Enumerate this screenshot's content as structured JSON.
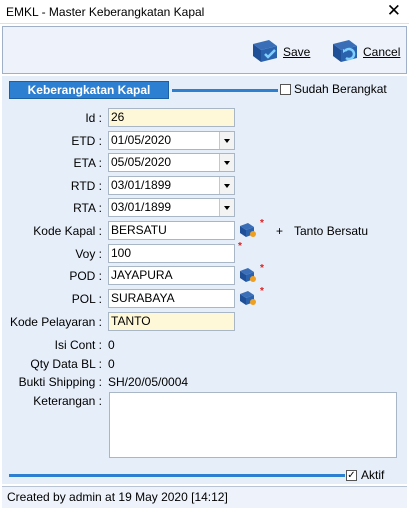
{
  "window": {
    "title": "EMKL - Master Keberangkatan Kapal"
  },
  "toolbar": {
    "save_label": "Save",
    "cancel_label": "Cancel"
  },
  "header": {
    "title": "Keberangkatan Kapal",
    "sudah_berangkat_label": "Sudah Berangkat",
    "sudah_berangkat_checked": false
  },
  "form": {
    "id": {
      "label": "Id :",
      "value": "26"
    },
    "etd": {
      "label": "ETD :",
      "value": "01/05/2020"
    },
    "eta": {
      "label": "ETA :",
      "value": "05/05/2020"
    },
    "rtd": {
      "label": "RTD :",
      "value": "03/01/1899"
    },
    "rta": {
      "label": "RTA :",
      "value": "03/01/1899"
    },
    "kode_kapal": {
      "label": "Kode Kapal :",
      "value": "BERSATU",
      "desc": "Tanto Bersatu",
      "plus": "+"
    },
    "voy": {
      "label": "Voy :",
      "value": "100"
    },
    "pod": {
      "label": "POD :",
      "value": "JAYAPURA"
    },
    "pol": {
      "label": "POL :",
      "value": "SURABAYA"
    },
    "kode_pelayaran": {
      "label": "Kode Pelayaran :",
      "value": "TANTO"
    },
    "isi_cont": {
      "label": "Isi Cont :",
      "value": "0"
    },
    "qty_data_bl": {
      "label": "Qty Data BL :",
      "value": "0"
    },
    "bukti_shipping": {
      "label": "Bukti Shipping :",
      "value": "SH/20/05/0004"
    },
    "keterangan": {
      "label": "Keterangan :",
      "value": ""
    },
    "required_mark": "*"
  },
  "footer": {
    "aktif_label": "Aktif",
    "aktif_checked": true
  },
  "status": {
    "text": "Created by admin at 19 May 2020 [14:12]"
  },
  "colors": {
    "accent": "#2d7fd2",
    "panel": "#e6eef9",
    "required": "#e02020",
    "readonly_field": "#fff8d8"
  }
}
